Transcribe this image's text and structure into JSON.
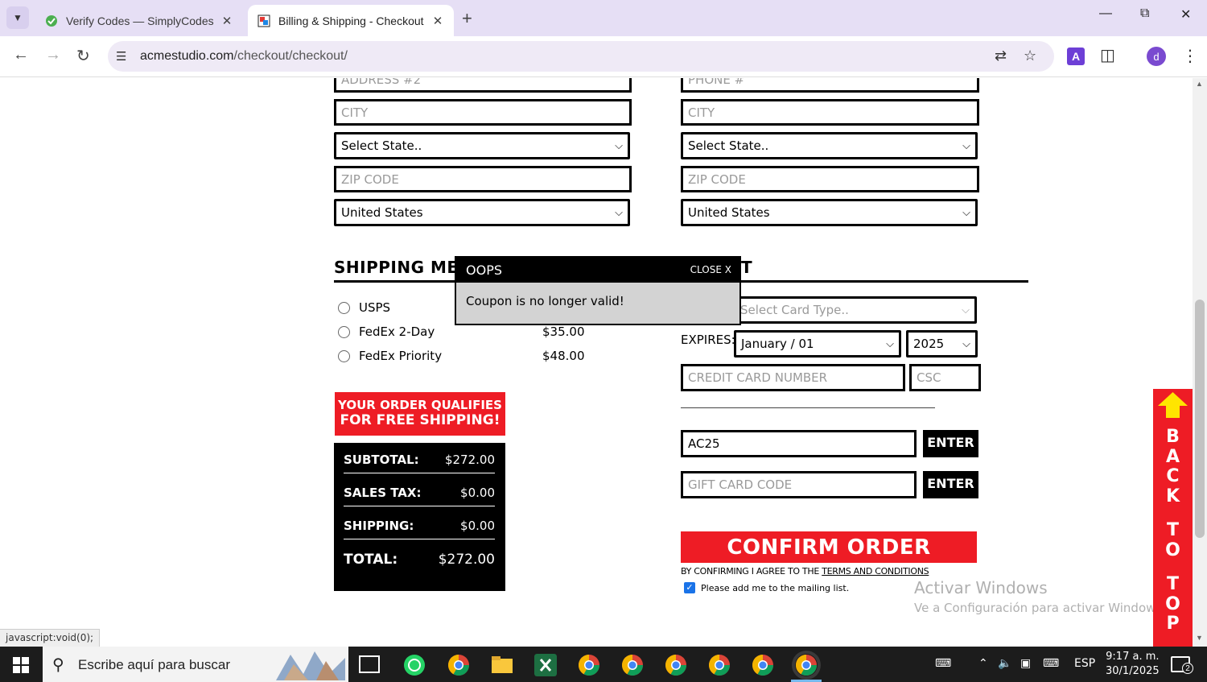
{
  "browser": {
    "tabs": [
      {
        "title": "Verify Codes — SimplyCodes",
        "active": false
      },
      {
        "title": "Billing & Shipping - Checkout S",
        "active": true
      }
    ],
    "url_domain": "acmestudio.com",
    "url_path": "/checkout/checkout/",
    "status_tip": "javascript:void(0);"
  },
  "billing": {
    "address2_placeholder": "ADDRESS #2",
    "city_placeholder": "CITY",
    "state_value": "Select State..",
    "zip_placeholder": "ZIP CODE",
    "country_value": "United States"
  },
  "shipping_address": {
    "phone_placeholder": "PHONE #",
    "city_placeholder": "CITY",
    "state_value": "Select State..",
    "zip_placeholder": "ZIP CODE",
    "country_value": "United States"
  },
  "shipping_method": {
    "title": "SHIPPING METHO",
    "options": [
      {
        "name": "USPS",
        "price": ""
      },
      {
        "name": "FedEx 2-Day",
        "price": "$35.00"
      },
      {
        "name": "FedEx Priority",
        "price": "$48.00"
      }
    ],
    "free_shipping_line1": "YOUR ORDER QUALIFIES",
    "free_shipping_line2": "FOR FREE SHIPPING!"
  },
  "totals": {
    "subtotal_label": "SUBTOTAL:",
    "subtotal": "$272.00",
    "tax_label": "SALES TAX:",
    "tax": "$0.00",
    "shipping_label": "SHIPPING:",
    "shipping": "$0.00",
    "total_label": "TOTAL:",
    "total": "$272.00"
  },
  "payment": {
    "title_fragment": "T",
    "card_type_value": "Select Card Type..",
    "expires_label": "EXPIRES:",
    "month_value": "January / 01",
    "year_value": "2025",
    "card_number_placeholder": "CREDIT CARD NUMBER",
    "csc_placeholder": "CSC",
    "coupon_value": "AC25",
    "coupon_enter": "ENTER",
    "gift_placeholder": "GIFT CARD CODE",
    "gift_enter": "ENTER",
    "confirm_label": "CONFIRM ORDER",
    "terms_prefix": "BY CONFIRMING I AGREE TO THE ",
    "terms_link": "TERMS AND CONDITIONS",
    "mailing_label": "Please add me to the mailing list.",
    "mailing_checked": true
  },
  "modal": {
    "title": "OOPS",
    "close_label": "CLOSE X",
    "message": "Coupon is no longer valid!"
  },
  "back_to_top": {
    "letters": [
      "B",
      "A",
      "C",
      "K",
      "",
      "T",
      "O",
      "",
      "T",
      "O",
      "P"
    ]
  },
  "watermark": {
    "line1": "Activar Windows",
    "line2": "Ve a Configuración para activar Windows."
  },
  "taskbar": {
    "search_placeholder": "Escribe aquí para buscar",
    "lang": "ESP",
    "time": "9:17 a. m.",
    "date": "30/1/2025",
    "notifications": "2"
  },
  "colors": {
    "brand_red": "#ee1c25",
    "tab_strip": "#e6dff5",
    "omnibox": "#efeaf6"
  }
}
